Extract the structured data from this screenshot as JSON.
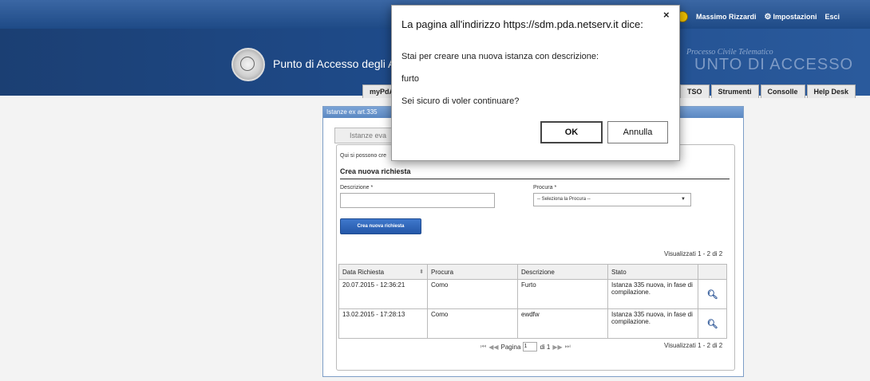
{
  "header": {
    "user_name": "Massimo Rizzardi",
    "settings_label": "Impostazioni",
    "exit_label": "Esci",
    "site_title": "Punto di Accesso degli Avvocati",
    "brand_small": "Processo Civile Telematico",
    "brand_big": "UNTO DI ACCESSO",
    "tabs_left": [
      "myPdA"
    ],
    "tabs_right": [
      "TSO",
      "Strumenti",
      "Consolle",
      "Help Desk"
    ]
  },
  "panel": {
    "header_label": "Istanze ex art.335",
    "subtab_label": "Istanze eva",
    "intro_text": "Qui si possono cre",
    "section_title": "Crea nuova richiesta",
    "description_label": "Descrizione *",
    "description_value": "",
    "procura_label": "Procura *",
    "procura_selected": "-- Seleziona la Procura --",
    "create_button": "Crea nuova richiesta",
    "shown_top": "Visualizzati 1 - 2 di 2",
    "shown_bottom": "Visualizzati 1 - 2 di 2"
  },
  "table": {
    "columns": [
      "Data Richiesta",
      "Procura",
      "Descrizione",
      "Stato",
      ""
    ],
    "rows": [
      {
        "date": "20.07.2015 - 12:36:21",
        "procura": "Como",
        "descrizione": "Furto",
        "stato": "Istanza 335 nuova, in fase di compilazione."
      },
      {
        "date": "13.02.2015 - 17:28:13",
        "procura": "Como",
        "descrizione": "ewdfw",
        "stato": "Istanza 335 nuova, in fase di compilazione."
      }
    ]
  },
  "pager": {
    "first": "⏮",
    "prev": "◀◀",
    "page_label": "Pagina",
    "page_value": "1",
    "of_label": "di 1",
    "next": "▶▶",
    "last": "⏭"
  },
  "dialog": {
    "title": "La pagina all'indirizzo https://sdm.pda.netserv.it dice:",
    "close_glyph": "×",
    "line1": "Stai per creare una nuova istanza con descrizione:",
    "line2": "furto",
    "line3": "Sei sicuro di voler continuare?",
    "ok_label": "OK",
    "cancel_label": "Annulla"
  }
}
